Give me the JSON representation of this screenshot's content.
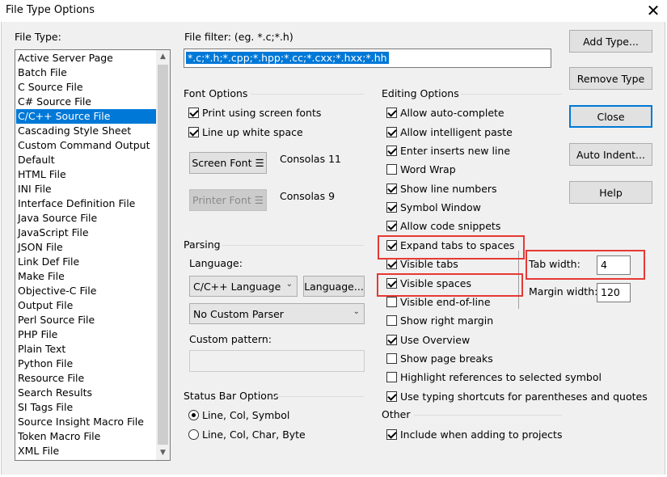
{
  "window": {
    "title": "File Type Options",
    "close_symbol": "✕"
  },
  "file_type": {
    "label": "File Type:",
    "items": [
      "Active Server Page",
      "Batch File",
      "C Source File",
      "C# Source File",
      "C/C++ Source File",
      "Cascading Style Sheet",
      "Custom Command Output",
      "Default",
      "HTML File",
      "INI File",
      "Interface Definition File",
      "Java Source File",
      "JavaScript File",
      "JSON File",
      "Link Def File",
      "Make File",
      "Objective-C File",
      "Output File",
      "Perl Source File",
      "PHP File",
      "Plain Text",
      "Python File",
      "Resource File",
      "Search Results",
      "SI Tags File",
      "Source Insight Macro File",
      "Token Macro File",
      "XML File"
    ],
    "selected": "C/C++ Source File"
  },
  "file_filter": {
    "label": "File filter: (eg. *.c;*.h)",
    "value": "*.c;*.h;*.cpp;*.hpp;*.cc;*.cxx;*.hxx;*.hh"
  },
  "font_options": {
    "label": "Font Options",
    "print_screen_fonts": "Print using screen fonts",
    "line_up_white_space": "Line up white space",
    "screen_font_button": "Screen Font",
    "screen_font_value": "Consolas 11",
    "printer_font_button": "Printer Font",
    "printer_font_value": "Consolas 9",
    "menu_glyph": "☰"
  },
  "parsing": {
    "label": "Parsing",
    "language_label": "Language:",
    "language_value": "C/C++ Language",
    "language_button": "Language...",
    "parser_value": "No Custom Parser",
    "custom_pattern_label": "Custom pattern:",
    "custom_pattern_value": "",
    "dropdown_glyph": "⌄"
  },
  "status_bar": {
    "label": "Status Bar Options",
    "option1": "Line, Col, Symbol",
    "option2": "Line, Col, Char, Byte"
  },
  "editing_options": {
    "label": "Editing Options",
    "items": [
      "Allow auto-complete",
      "Allow intelligent paste",
      "Enter inserts new line",
      "Word Wrap",
      "Show line numbers",
      "Symbol Window",
      "Allow code snippets",
      "Expand tabs to spaces",
      "Visible tabs",
      "Visible spaces",
      "Visible end-of-line",
      "Show right margin",
      "Use Overview",
      "Show page breaks",
      "Highlight references to selected symbol",
      "Use typing shortcuts for parentheses and quotes"
    ],
    "checked": [
      true,
      true,
      true,
      false,
      true,
      true,
      true,
      true,
      true,
      true,
      false,
      false,
      true,
      false,
      false,
      true
    ]
  },
  "tab_width": {
    "label": "Tab width:",
    "value": "4"
  },
  "margin_width": {
    "label": "Margin width:",
    "value": "120"
  },
  "other": {
    "label": "Other",
    "include_projects": "Include when adding to projects"
  },
  "buttons": {
    "add_type": "Add Type...",
    "remove_type": "Remove Type",
    "close": "Close",
    "auto_indent": "Auto Indent...",
    "help": "Help"
  },
  "colors": {
    "selection": "#0078d7",
    "highlight_box": "#e53935",
    "dialog_bg": "#f0f0f0"
  }
}
